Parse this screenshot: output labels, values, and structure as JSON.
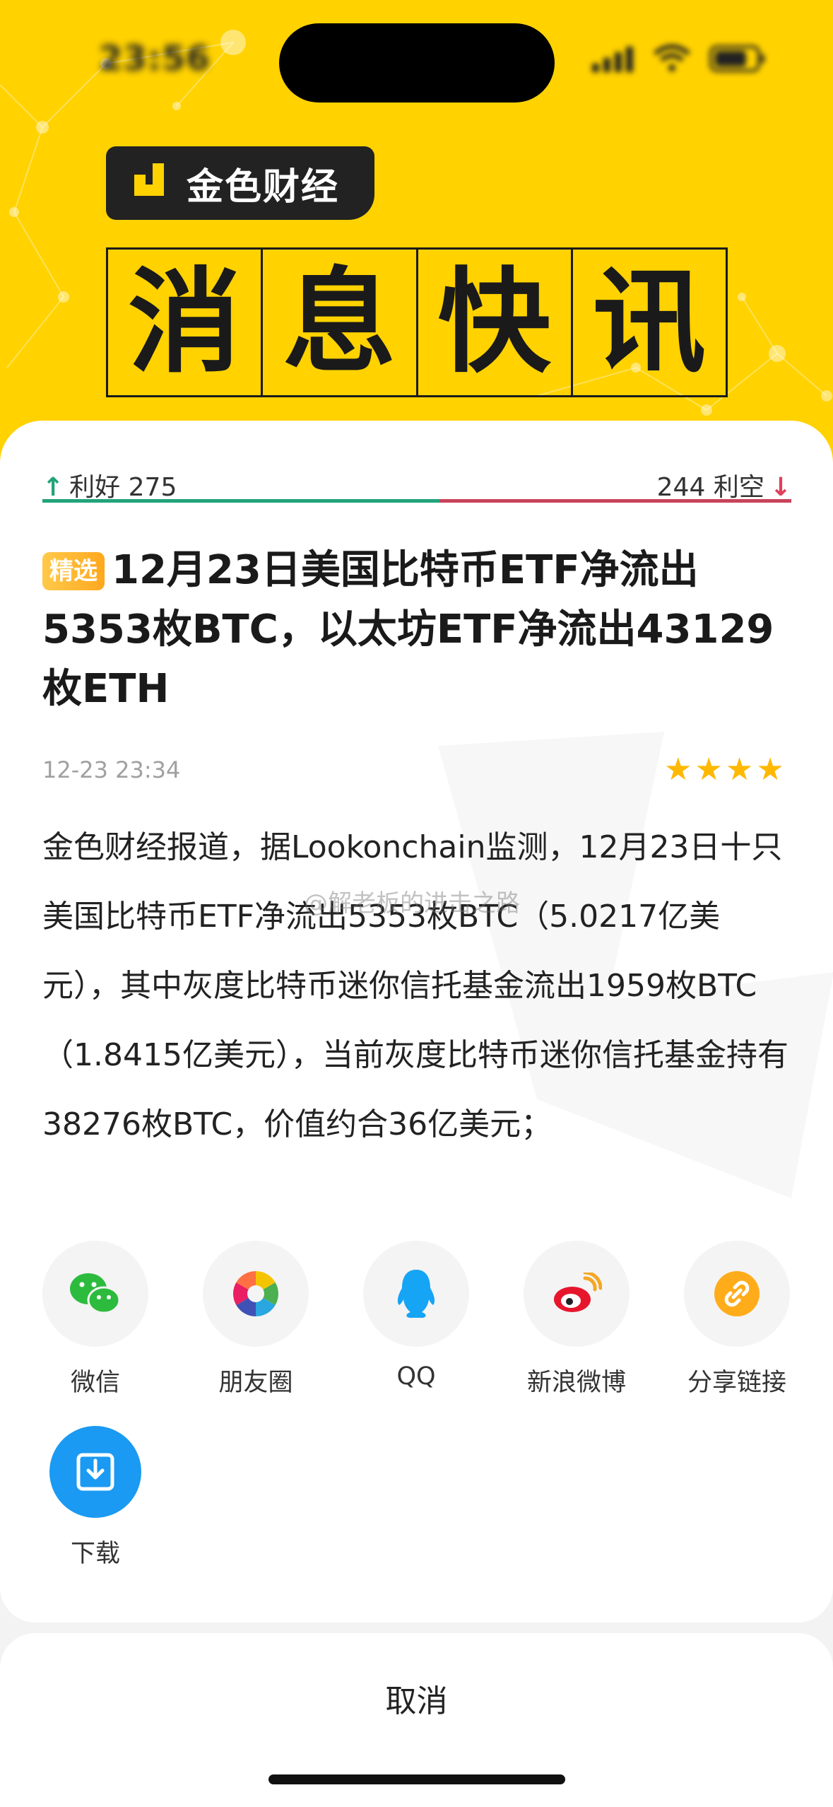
{
  "status_bar": {
    "time": "23:56"
  },
  "header": {
    "brand": "金色财经",
    "banner_chars": [
      "消",
      "息",
      "快",
      "讯"
    ],
    "colors": {
      "background": "#FFD200",
      "dark": "#1a1a1a"
    }
  },
  "sentiment": {
    "bullish_label": "利好",
    "bullish_count": "275",
    "bearish_label": "利空",
    "bearish_count": "244",
    "colors": {
      "bullish": "#22a37a",
      "bearish": "#c8435a"
    }
  },
  "article": {
    "tag": "精选",
    "title": "12月23日美国比特币ETF净流出5353枚BTC，以太坊ETF净流出43129枚ETH",
    "datetime": "12-23 23:34",
    "rating": 4,
    "rating_max": 4,
    "body": "金色财经报道，据Lookonchain监测，12月23日十只美国比特币ETF净流出5353枚BTC（5.0217亿美元），其中灰度比特币迷你信托基金流出1959枚BTC（1.8415亿美元），当前灰度比特币迷你信托基金持有38276枚BTC，价值约合36亿美元；",
    "watermark": "@解老板的进击之路"
  },
  "share": {
    "items": [
      {
        "label": "微信",
        "icon": "wechat-icon"
      },
      {
        "label": "朋友圈",
        "icon": "moments-icon"
      },
      {
        "label": "QQ",
        "icon": "qq-icon"
      },
      {
        "label": "新浪微博",
        "icon": "weibo-icon"
      },
      {
        "label": "分享链接",
        "icon": "link-icon"
      },
      {
        "label": "下载",
        "icon": "download-icon"
      }
    ]
  },
  "cancel_label": "取消"
}
